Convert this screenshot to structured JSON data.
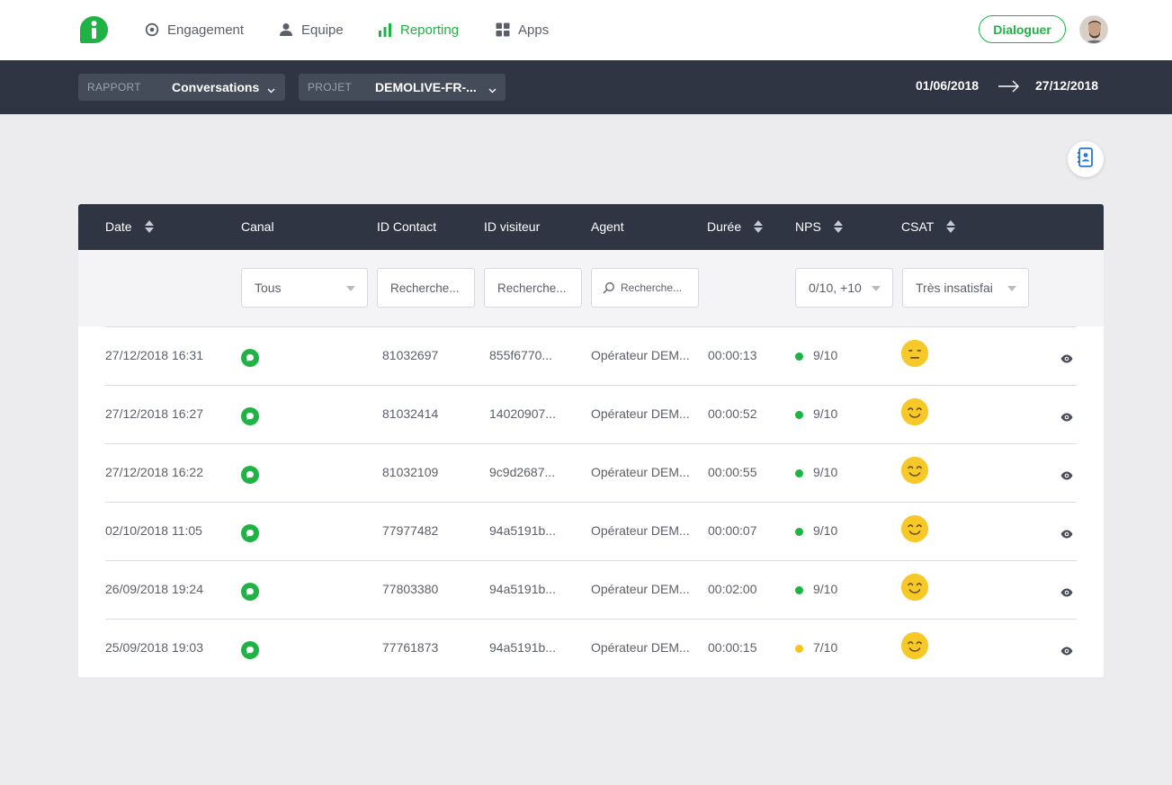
{
  "nav": {
    "items": [
      {
        "label": "Engagement",
        "icon": "target-icon"
      },
      {
        "label": "Equipe",
        "icon": "user-icon"
      },
      {
        "label": "Reporting",
        "icon": "bar-chart-icon"
      },
      {
        "label": "Apps",
        "icon": "grid-icon"
      }
    ],
    "active": "Reporting",
    "cta_label": "Dialoguer"
  },
  "filters": {
    "rapport": {
      "label": "RAPPORT",
      "value": "Conversations"
    },
    "projet": {
      "label": "PROJET",
      "value": "DEMOLIVE-FR-..."
    },
    "date_start": "01/06/2018",
    "date_end": "27/12/2018"
  },
  "table": {
    "columns": {
      "date": "Date",
      "canal": "Canal",
      "id_contact": "ID Contact",
      "id_visiteur": "ID visiteur",
      "agent": "Agent",
      "duree": "Durée",
      "nps": "NPS",
      "csat": "CSAT"
    },
    "column_filters": {
      "canal": "Tous",
      "id_contact_placeholder": "Recherche...",
      "id_visiteur_placeholder": "Recherche...",
      "agent_placeholder": "Recherche...",
      "nps": "0/10, +10",
      "csat": "Très insatisfai"
    },
    "rows": [
      {
        "date": "27/12/2018 16:31",
        "canal": "chat",
        "id_contact": "81032697",
        "id_visiteur": "855f6770...",
        "agent": "Opérateur DEM...",
        "duree": "00:00:13",
        "nps": "9/10",
        "nps_color": "#1fb345",
        "csat": "neutral-face-icon"
      },
      {
        "date": "27/12/2018 16:27",
        "canal": "chat",
        "id_contact": "81032414",
        "id_visiteur": "14020907...",
        "agent": "Opérateur DEM...",
        "duree": "00:00:52",
        "nps": "9/10",
        "nps_color": "#1fb345",
        "csat": "smile-face-icon"
      },
      {
        "date": "27/12/2018 16:22",
        "canal": "chat",
        "id_contact": "81032109",
        "id_visiteur": "9c9d2687...",
        "agent": "Opérateur DEM...",
        "duree": "00:00:55",
        "nps": "9/10",
        "nps_color": "#1fb345",
        "csat": "smile-face-icon"
      },
      {
        "date": "02/10/2018 11:05",
        "canal": "chat",
        "id_contact": "77977482",
        "id_visiteur": "94a5191b...",
        "agent": "Opérateur DEM...",
        "duree": "00:00:07",
        "nps": "9/10",
        "nps_color": "#1fb345",
        "csat": "smile-face-icon"
      },
      {
        "date": "26/09/2018 19:24",
        "canal": "chat",
        "id_contact": "77803380",
        "id_visiteur": "94a5191b...",
        "agent": "Opérateur DEM...",
        "duree": "00:02:00",
        "nps": "9/10",
        "nps_color": "#1fb345",
        "csat": "smile-face-icon"
      },
      {
        "date": "25/09/2018 19:03",
        "canal": "chat",
        "id_contact": "77761873",
        "id_visiteur": "94a5191b...",
        "agent": "Opérateur DEM...",
        "duree": "00:00:15",
        "nps": "7/10",
        "nps_color": "#f5c518",
        "csat": "smile-face-icon"
      }
    ]
  },
  "colors": {
    "accent": "#1fb345",
    "dark": "#2f3542",
    "warning": "#f5c518"
  }
}
